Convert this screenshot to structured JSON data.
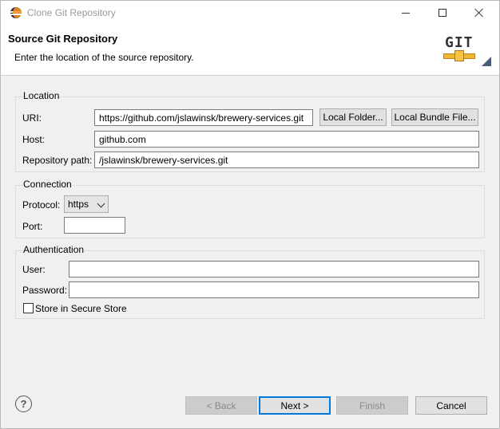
{
  "window": {
    "title": "Clone Git Repository",
    "icon": "eclipse-icon"
  },
  "header": {
    "title": "Source Git Repository",
    "description": "Enter the location of the source repository.",
    "logo_text": "GIT"
  },
  "location": {
    "label": "Location",
    "uri_label": "URI:",
    "uri_value": "https://github.com/jslawinsk/brewery-services.git",
    "local_folder_button": "Local Folder...",
    "local_bundle_button": "Local Bundle File...",
    "host_label": "Host:",
    "host_value": "github.com",
    "repo_path_label": "Repository path:",
    "repo_path_value": "/jslawinsk/brewery-services.git"
  },
  "connection": {
    "label": "Connection",
    "protocol_label": "Protocol:",
    "protocol_value": "https",
    "port_label": "Port:",
    "port_value": ""
  },
  "authentication": {
    "label": "Authentication",
    "user_label": "User:",
    "user_value": "",
    "password_label": "Password:",
    "password_value": "",
    "store_label": "Store in Secure Store",
    "store_checked": false
  },
  "footer": {
    "help_glyph": "?",
    "back": "< Back",
    "next": "Next >",
    "finish": "Finish",
    "cancel": "Cancel"
  }
}
